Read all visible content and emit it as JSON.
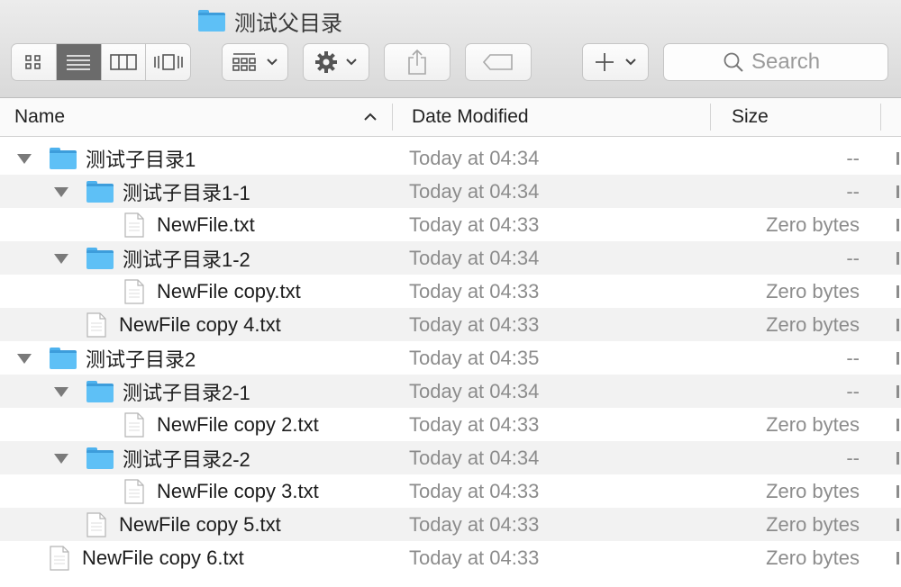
{
  "window": {
    "title": "测试父目录"
  },
  "toolbar": {
    "search_placeholder": "Search"
  },
  "columns": {
    "name": "Name",
    "date": "Date Modified",
    "size": "Size"
  },
  "rows": [
    {
      "name": "测试子目录1",
      "date": "Today at 04:34",
      "size": "--",
      "type": "folder",
      "depth": 0,
      "expanded": true
    },
    {
      "name": "测试子目录1-1",
      "date": "Today at 04:34",
      "size": "--",
      "type": "folder",
      "depth": 1,
      "expanded": true
    },
    {
      "name": "NewFile.txt",
      "date": "Today at 04:33",
      "size": "Zero bytes",
      "type": "file",
      "depth": 2
    },
    {
      "name": "测试子目录1-2",
      "date": "Today at 04:34",
      "size": "--",
      "type": "folder",
      "depth": 1,
      "expanded": true
    },
    {
      "name": "NewFile copy.txt",
      "date": "Today at 04:33",
      "size": "Zero bytes",
      "type": "file",
      "depth": 2
    },
    {
      "name": "NewFile copy 4.txt",
      "date": "Today at 04:33",
      "size": "Zero bytes",
      "type": "file",
      "depth": 1
    },
    {
      "name": "测试子目录2",
      "date": "Today at 04:35",
      "size": "--",
      "type": "folder",
      "depth": 0,
      "expanded": true
    },
    {
      "name": "测试子目录2-1",
      "date": "Today at 04:34",
      "size": "--",
      "type": "folder",
      "depth": 1,
      "expanded": true
    },
    {
      "name": "NewFile copy 2.txt",
      "date": "Today at 04:33",
      "size": "Zero bytes",
      "type": "file",
      "depth": 2
    },
    {
      "name": "测试子目录2-2",
      "date": "Today at 04:34",
      "size": "--",
      "type": "folder",
      "depth": 1,
      "expanded": true
    },
    {
      "name": "NewFile copy 3.txt",
      "date": "Today at 04:33",
      "size": "Zero bytes",
      "type": "file",
      "depth": 2
    },
    {
      "name": "NewFile copy 5.txt",
      "date": "Today at 04:33",
      "size": "Zero bytes",
      "type": "file",
      "depth": 1
    },
    {
      "name": "NewFile copy 6.txt",
      "date": "Today at 04:33",
      "size": "Zero bytes",
      "type": "file",
      "depth": 0
    }
  ],
  "icons": {
    "view_icon": "icon-view-icon",
    "view_list": "list-view-icon",
    "view_columns": "column-view-icon",
    "view_gallery": "cover-flow-icon",
    "arrange": "arrange-icon",
    "action": "gear-icon",
    "share": "share-icon",
    "tags": "tag-icon",
    "new": "plus-icon",
    "search": "search-icon",
    "sort": "sort-ascending-icon"
  },
  "colors": {
    "folder": "#5ec0f6",
    "selected_view": "#6b6b6b",
    "secondary_text": "#8c8c8c"
  }
}
